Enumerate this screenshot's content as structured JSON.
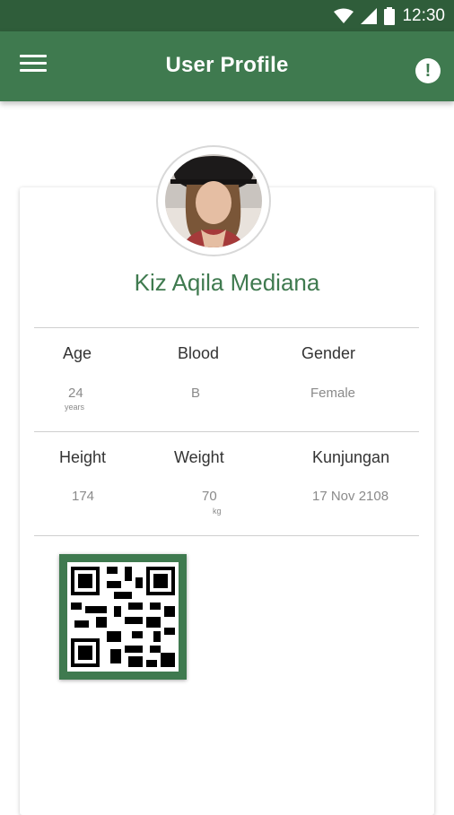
{
  "status_bar": {
    "time": "12:30"
  },
  "app_bar": {
    "title": "User Profile",
    "alert_glyph": "!"
  },
  "profile": {
    "name": "Kiz Aqila Mediana",
    "age_label": "Age",
    "age_value": "24",
    "age_unit": "years",
    "blood_label": "Blood",
    "blood_value": "B",
    "gender_label": "Gender",
    "gender_value": "Female",
    "height_label": "Height",
    "height_value": "174",
    "weight_label": "Weight",
    "weight_value": "70",
    "weight_unit": "kg",
    "visit_label": "Kunjungan",
    "visit_value": "17 Nov 2108"
  },
  "colors": {
    "primary": "#3f7a4f",
    "status_bar": "#2f5d3a"
  },
  "icons": [
    "wifi-icon",
    "signal-icon",
    "battery-icon",
    "menu-icon",
    "alert-icon",
    "qr-code-icon"
  ]
}
